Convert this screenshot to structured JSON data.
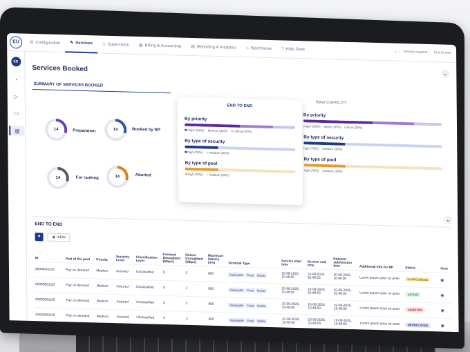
{
  "app": {
    "logo_text": "EU",
    "tabs": [
      {
        "label": "Configuration",
        "icon": "gear-icon"
      },
      {
        "label": "Services",
        "icon": "services-icon"
      },
      {
        "label": "Supervision",
        "icon": "shield-icon"
      },
      {
        "label": "Billing & Accounting",
        "icon": "billing-icon"
      },
      {
        "label": "Reporting & Analytics",
        "icon": "chart-icon"
      },
      {
        "label": "Warehouse",
        "icon": "warehouse-icon"
      },
      {
        "label": "Help Desk",
        "icon": "help-icon"
      }
    ],
    "breadcrumb": [
      "Service request",
      "End to end"
    ]
  },
  "sidebar": {
    "avatar": "EE"
  },
  "page": {
    "title": "Services Booked",
    "summary_label": "SUMMARY OF SERVICES BOOKED",
    "donuts": [
      {
        "label": "Preparation",
        "value": "14",
        "color": "#6a3fb5"
      },
      {
        "label": "Booked by RP",
        "value": "14",
        "color": "#2e4fb8"
      },
      {
        "label": "For ranking",
        "value": "14",
        "color": "#555b66"
      },
      {
        "label": "Aborted",
        "value": "14",
        "color": "#e07a1a"
      }
    ]
  },
  "end_to_end_card": {
    "title": "END TO END",
    "priority": {
      "title": "By priority",
      "legend": [
        "major (50%)",
        "minor (30%)",
        "critical (20%)"
      ],
      "values": [
        0.5,
        0.3,
        0.2
      ],
      "colors": [
        "#5b2a9c",
        "#9d7bd6",
        "#cfc0ee"
      ]
    },
    "security": {
      "title": "By type of security",
      "legend": [
        "high (70%)",
        "medium (30%)"
      ],
      "values": [
        0.7,
        0.3
      ],
      "colors": [
        "#1f3a8a",
        "#c9d3ef"
      ]
    },
    "pool": {
      "title": "By type of pool",
      "legend": [
        "high (70%)",
        "medium (30%)"
      ],
      "values": [
        0.7,
        0.3
      ],
      "colors": [
        "#e59b2a",
        "#f6e2bf"
      ]
    }
  },
  "raw_capacity": {
    "title": "RAW CAPACITY",
    "priority": {
      "title": "By priority",
      "legend": [
        "major (50%)",
        "minor (30%)",
        "critical (20%)"
      ]
    },
    "security": {
      "title": "By type of security",
      "legend": [
        "high (70%)",
        "medium (30%)"
      ]
    },
    "pool": {
      "title": "By type of pool",
      "legend": [
        "high (70%)",
        "medium (30%)"
      ]
    }
  },
  "table": {
    "title": "END TO END",
    "view_label": "VIEW",
    "columns": [
      "ID",
      "Part of the pool",
      "Priority",
      "Security Level",
      "Classification Level",
      "Forward throughput (Mbps)",
      "Return throughput (Mbps)",
      "Maximum latency (ms)",
      "Terminal Type",
      "Service start time",
      "Service end time",
      "Request submission time",
      "Additional info for RP",
      "Status",
      "View"
    ],
    "rows": [
      {
        "id": "00000001/25",
        "pool": "Pay on demand",
        "priority": "Medium",
        "security": "Assured",
        "classification": "Unclassified",
        "fwd": "5",
        "ret": "2",
        "latency": "800",
        "start": "10-08-2025, 10:48:00",
        "end": "10-08-2025, 10:48:00",
        "submit": "10-08-2025, 10:48:00",
        "info": "Lorem ipsum dolor sit amet",
        "status": "IN PROGRESS",
        "status_bg": "#fff1b8",
        "status_fg": "#8a6a00"
      },
      {
        "id": "00000001/25",
        "pool": "Pay on demand",
        "priority": "Medium",
        "security": "Assured",
        "classification": "Unclassified",
        "fwd": "5",
        "ret": "2",
        "latency": "800",
        "start": "10-08-2025, 10:48:00",
        "end": "10-08-2025, 10:48:00",
        "submit": "10-08-2025, 10:48:00",
        "info": "Lorem ipsum dolor sit amet",
        "status": "ACTIVE",
        "status_bg": "#dff5e3",
        "status_fg": "#1c7a36"
      },
      {
        "id": "00000001/25",
        "pool": "Pay on demand",
        "priority": "Medium",
        "security": "Assured",
        "classification": "Unclassified",
        "fwd": "5",
        "ret": "2",
        "latency": "800",
        "start": "10-08-2025, 10:48:00",
        "end": "10-08-2025, 10:48:00",
        "submit": "10-08-2025, 10:48:00",
        "info": "Lorem ipsum dolor sit amet",
        "status": "ABORTED",
        "status_bg": "#fde0e0",
        "status_fg": "#b3261e"
      },
      {
        "id": "00000001/25",
        "pool": "Pay on demand",
        "priority": "Medium",
        "security": "Assured",
        "classification": "Unclassified",
        "fwd": "5",
        "ret": "2",
        "latency": "800",
        "start": "10-08-2025, 10:48:00",
        "end": "10-08-2025, 10:48:00",
        "submit": "10-08-2025, 10:48:00",
        "info": "Lorem ipsum dolor sit amet",
        "status": "DEPRECATED",
        "status_bg": "#dde4f7",
        "status_fg": "#1f3a8a"
      },
      {
        "id": "00000001/25",
        "pool": "Pay on demand",
        "priority": "Medium",
        "security": "Assured",
        "classification": "Unclassified",
        "fwd": "5",
        "ret": "2",
        "latency": "800",
        "start": "10-08-2025, 10:48:00",
        "end": "10-08-2025, 10:48:00",
        "submit": "10-08-2025, 10:48:00",
        "info": "",
        "status": "",
        "status_bg": "#ffffff",
        "status_fg": "#1e2a5a"
      }
    ],
    "terminal_chips": [
      "Deployable",
      "Fixed",
      "Mobile"
    ]
  }
}
